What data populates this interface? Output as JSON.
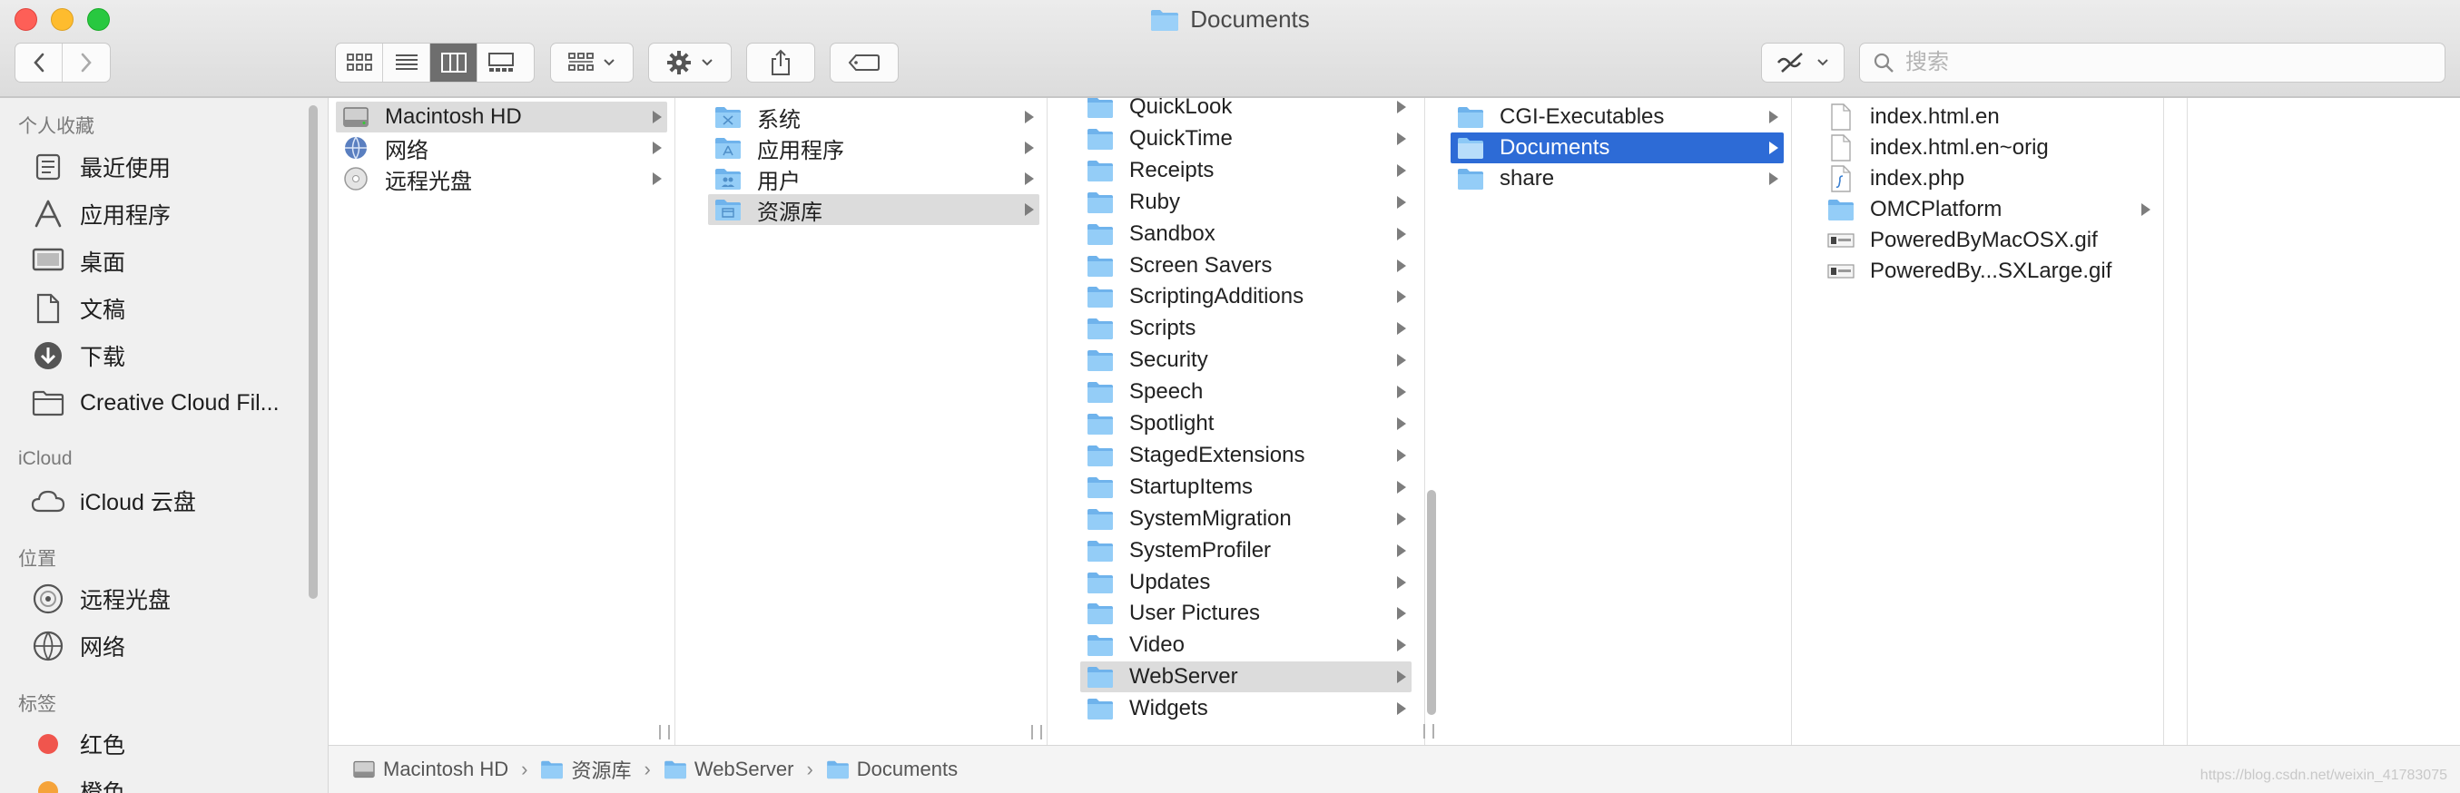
{
  "window": {
    "title": "Documents"
  },
  "toolbar": {
    "back_icon": "chevron-left-icon",
    "forward_icon": "chevron-right-icon",
    "view_modes": [
      "icon-view",
      "list-view",
      "column-view",
      "gallery-view"
    ],
    "active_view": "column-view",
    "search_placeholder": "搜索"
  },
  "sidebar": {
    "favorites_header": "个人收藏",
    "favorites": [
      {
        "label": "最近使用",
        "icon": "clock-icon"
      },
      {
        "label": "应用程序",
        "icon": "applications-icon"
      },
      {
        "label": "桌面",
        "icon": "desktop-icon"
      },
      {
        "label": "文稿",
        "icon": "documents-icon"
      },
      {
        "label": "下载",
        "icon": "download-icon"
      },
      {
        "label": "Creative Cloud Fil...",
        "icon": "folder-icon"
      }
    ],
    "icloud_header": "iCloud",
    "icloud": [
      {
        "label": "iCloud 云盘",
        "icon": "cloud-icon"
      }
    ],
    "locations_header": "位置",
    "locations": [
      {
        "label": "远程光盘",
        "icon": "disc-icon"
      },
      {
        "label": "网络",
        "icon": "network-icon"
      }
    ],
    "tags_header": "标签",
    "tags": [
      {
        "label": "红色",
        "color": "#f0554d"
      },
      {
        "label": "橙色",
        "color": "#f5a33a"
      }
    ]
  },
  "columns": {
    "col1": [
      {
        "label": "Macintosh HD",
        "icon": "hard-drive-icon",
        "state": "gray"
      },
      {
        "label": "网络",
        "icon": "network-icon"
      },
      {
        "label": "远程光盘",
        "icon": "disc-icon"
      }
    ],
    "col2": [
      {
        "label": "系统",
        "icon": "folder-icon"
      },
      {
        "label": "应用程序",
        "icon": "folder-icon"
      },
      {
        "label": "用户",
        "icon": "folder-icon"
      },
      {
        "label": "资源库",
        "icon": "folder-icon",
        "state": "gray"
      }
    ],
    "col3": [
      {
        "label": "QuickLook"
      },
      {
        "label": "QuickTime"
      },
      {
        "label": "Receipts"
      },
      {
        "label": "Ruby"
      },
      {
        "label": "Sandbox"
      },
      {
        "label": "Screen Savers"
      },
      {
        "label": "ScriptingAdditions"
      },
      {
        "label": "Scripts"
      },
      {
        "label": "Security"
      },
      {
        "label": "Speech"
      },
      {
        "label": "Spotlight"
      },
      {
        "label": "StagedExtensions"
      },
      {
        "label": "StartupItems"
      },
      {
        "label": "SystemMigration"
      },
      {
        "label": "SystemProfiler"
      },
      {
        "label": "Updates"
      },
      {
        "label": "User Pictures"
      },
      {
        "label": "Video"
      },
      {
        "label": "WebServer",
        "state": "gray"
      },
      {
        "label": "Widgets"
      }
    ],
    "col4": [
      {
        "label": "CGI-Executables"
      },
      {
        "label": "Documents",
        "state": "blue"
      },
      {
        "label": "share"
      }
    ],
    "col5": [
      {
        "label": "index.html.en",
        "icon": "file-icon",
        "arrow": false
      },
      {
        "label": "index.html.en~orig",
        "icon": "file-icon",
        "arrow": false
      },
      {
        "label": "index.php",
        "icon": "php-file-icon",
        "arrow": false
      },
      {
        "label": "OMCPlatform",
        "icon": "folder-icon",
        "arrow": true
      },
      {
        "label": "PoweredByMacOSX.gif",
        "icon": "image-file-icon",
        "arrow": false
      },
      {
        "label": "PoweredBy...SXLarge.gif",
        "icon": "image-file-icon",
        "arrow": false
      }
    ]
  },
  "pathbar": {
    "crumbs": [
      {
        "label": "Macintosh HD",
        "icon": "hard-drive-icon"
      },
      {
        "label": "资源库",
        "icon": "folder-icon"
      },
      {
        "label": "WebServer",
        "icon": "folder-icon"
      },
      {
        "label": "Documents",
        "icon": "folder-icon"
      }
    ]
  },
  "watermark": "https://blog.csdn.net/weixin_41783075"
}
